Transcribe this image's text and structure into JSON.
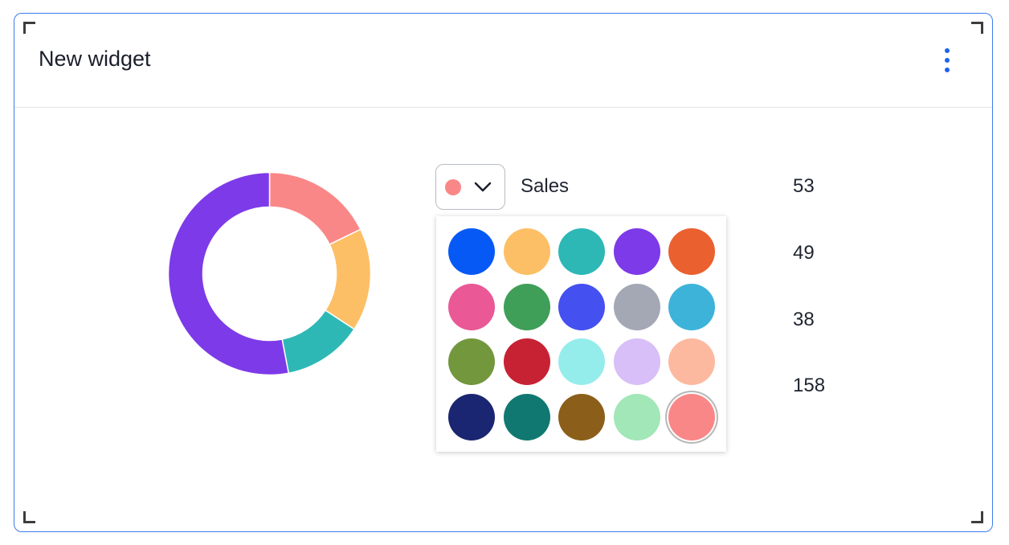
{
  "widget": {
    "title": "New widget",
    "menu_icon": "kebab-menu-icon"
  },
  "chart_data": {
    "type": "pie",
    "variant": "donut",
    "categories": [
      "Sales",
      "",
      "",
      ""
    ],
    "values": [
      53,
      49,
      38,
      158
    ],
    "colors": [
      "#fa8787",
      "#fdbf66",
      "#2db8b6",
      "#7d3ae8"
    ]
  },
  "legend": {
    "items": [
      {
        "label": "Sales",
        "value": "53",
        "color": "#fa8787"
      },
      {
        "label": "",
        "value": "49",
        "color": "#fdbf66"
      },
      {
        "label": "",
        "value": "38",
        "color": "#2db8b6"
      },
      {
        "label": "",
        "value": "158",
        "color": "#7d3ae8"
      }
    ],
    "dropdown_icon": "chevron-down-icon"
  },
  "palette": {
    "selected": "#fa8787",
    "colors": [
      "#0659f5",
      "#fdbf66",
      "#2db8b6",
      "#7d3ae8",
      "#ea602f",
      "#ea5896",
      "#3f9e58",
      "#4450f0",
      "#a3a8b4",
      "#3eb3da",
      "#73973d",
      "#c72233",
      "#95edeb",
      "#d8bff7",
      "#fdb9a0",
      "#1a2671",
      "#117871",
      "#8b5f19",
      "#a2e7b7",
      "#fa8787"
    ]
  }
}
